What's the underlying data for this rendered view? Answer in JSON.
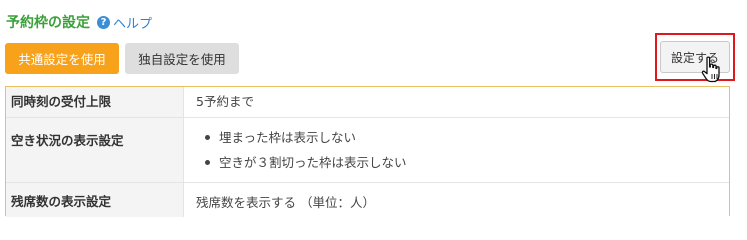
{
  "header": {
    "title": "予約枠の設定",
    "help_icon_glyph": "?",
    "help_label": "ヘルプ"
  },
  "toolbar": {
    "common_label": "共通設定を使用",
    "own_label": "独自設定を使用",
    "settings_label": "設定する"
  },
  "table": {
    "rows": [
      {
        "label": "同時刻の受付上限",
        "value": "5予約まで"
      },
      {
        "label": "空き状況の表示設定",
        "items": [
          "埋まった枠は表示しない",
          "空きが３割切った枠は表示しない"
        ]
      },
      {
        "label": "残席数の表示設定",
        "value": "残席数を表示する （単位：人）"
      }
    ]
  },
  "colors": {
    "title": "#3aa13a",
    "link": "#2f83d0",
    "primary_button": "#f8a21c",
    "secondary_button": "#dedede",
    "highlight": "#e0181b",
    "table_border": "#eac060"
  },
  "icons": [
    "help-icon",
    "hand-pointer-cursor-icon"
  ]
}
